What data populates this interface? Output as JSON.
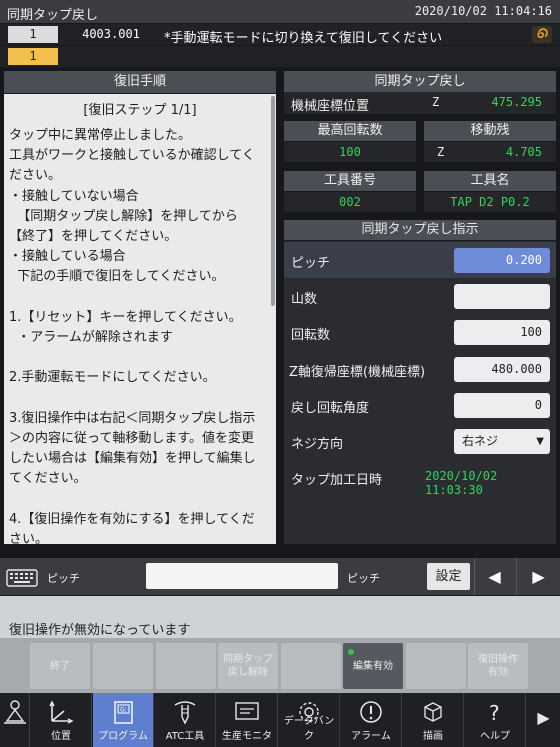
{
  "title": "同期タップ戻し",
  "datetime": "2020/10/02 11:04:16",
  "message1": {
    "number": "1",
    "code": "4003.001",
    "text": "*手動運転モードに切り換えて復旧してください"
  },
  "message2": {
    "number": "1"
  },
  "left_panel": {
    "header": "復旧手順",
    "step": "[復旧ステップ 1/1]",
    "lines": [
      "タップ中に異常停止しました。",
      "工具がワークと接触しているか確認してく",
      "ださい。",
      "・接触していない場合",
      "  【同期タップ戻し解除】を押してから",
      "【終了】を押してください。",
      "・接触している場合",
      "  下記の手順で復旧をしてください。",
      "",
      "1.【リセット】キーを押してください。",
      "  ・アラームが解除されます",
      "",
      "2.手動運転モードにしてください。",
      "",
      "3.復旧操作中は右記＜同期タップ戻し指示",
      "＞の内容に従って軸移動します。値を変更",
      "したい場合は【編集有効】を押して編集し",
      "てください。",
      "",
      "4.【復旧操作を有効にする】を押してくだ",
      "さい。"
    ]
  },
  "right_panel": {
    "header": "同期タップ戻し",
    "machine_pos_label": "機械座標位置",
    "machine_pos_axis": "Z",
    "machine_pos_value": "475.295",
    "max_rpm_header": "最高回転数",
    "max_rpm_value": "100",
    "remaining_header": "移動残",
    "remaining_axis": "Z",
    "remaining_value": "4.705",
    "tool_no_header": "工具番号",
    "tool_no_value": "002",
    "tool_name_header": "工具名",
    "tool_name_value": "TAP D2 P0.2"
  },
  "instruction": {
    "header": "同期タップ戻し指示",
    "pitch_label": "ピッチ",
    "pitch_value": "0.200",
    "threads_label": "山数",
    "threads_value": "",
    "rotations_label": "回転数",
    "rotations_value": "100",
    "z_return_label": "Z軸復帰座標(機械座標)",
    "z_return_value": "480.000",
    "return_angle_label": "戻し回転角度",
    "return_angle_value": "0",
    "thread_dir_label": "ネジ方向",
    "thread_dir_value": "右ネジ",
    "tap_date_label": "タップ加工日時",
    "tap_date_value": "2020/10/02 11:03:30"
  },
  "input_bar": {
    "label_left": "ピッチ",
    "field_value": "",
    "label_right": "ピッチ",
    "set_button": "設定"
  },
  "status_message": "復旧操作が無効になっています",
  "function_keys": [
    {
      "label": "終了",
      "active": false
    },
    {
      "label": "",
      "active": false
    },
    {
      "label": "",
      "active": false
    },
    {
      "label": "同期タップ\n戻し解除",
      "active": false
    },
    {
      "label": "",
      "active": false
    },
    {
      "label": "編集有効",
      "active": true
    },
    {
      "label": "",
      "active": false
    },
    {
      "label": "復旧操作\n有効",
      "active": false
    }
  ],
  "nav": {
    "items": [
      {
        "label": "",
        "icon": "operator-icon"
      },
      {
        "label": "位置",
        "icon": "axes-icon"
      },
      {
        "label": "プログラム",
        "icon": "program-icon"
      },
      {
        "label": "ATC工具",
        "icon": "tool-icon"
      },
      {
        "label": "生産モニタ",
        "icon": "monitor-icon"
      },
      {
        "label": "データバンク",
        "icon": "gear-icon"
      },
      {
        "label": "アラーム",
        "icon": "alarm-icon"
      },
      {
        "label": "描画",
        "icon": "cube-icon"
      },
      {
        "label": "ヘルプ",
        "icon": "help-icon"
      }
    ],
    "active_index": 2
  },
  "colors": {
    "accent_blue": "#5e7fcf",
    "value_green": "#33d45a",
    "warning_yellow": "#f3c14b"
  }
}
